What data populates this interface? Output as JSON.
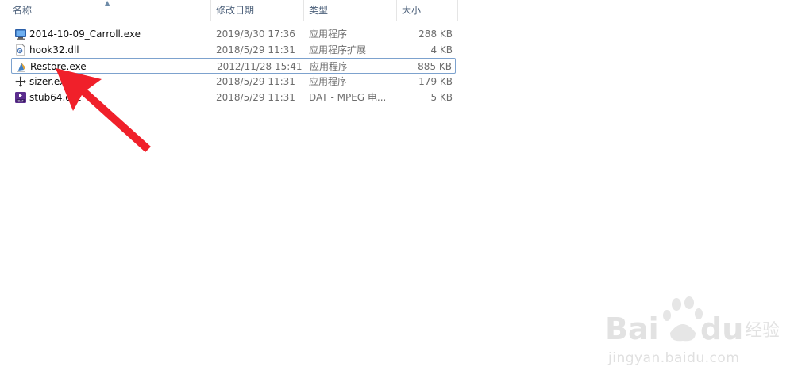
{
  "columns": {
    "name": "名称",
    "date": "修改日期",
    "type": "类型",
    "size": "大小"
  },
  "files": [
    {
      "name": "2014-10-09_Carroll.exe",
      "date": "2019/3/30 17:36",
      "type": "应用程序",
      "size": "288 KB",
      "icon": "monitor-app-icon"
    },
    {
      "name": "hook32.dll",
      "date": "2018/5/29 11:31",
      "type": "应用程序扩展",
      "size": "4 KB",
      "icon": "dll-file-icon"
    },
    {
      "name": "Restore.exe",
      "date": "2012/11/28 15:41",
      "type": "应用程序",
      "size": "885 KB",
      "icon": "restore-app-icon",
      "selected": true
    },
    {
      "name": "sizer.exe",
      "date": "2018/5/29 11:31",
      "type": "应用程序",
      "size": "179 KB",
      "icon": "move-arrows-icon"
    },
    {
      "name": "stub64.dat",
      "date": "2018/5/29 11:31",
      "type": "DAT - MPEG 电...",
      "size": "5 KB",
      "icon": "dat-file-icon"
    }
  ],
  "watermark": {
    "logo": "Baidu 经验",
    "url": "jingyan.baidu.com"
  },
  "colors": {
    "arrow": "#f0202a",
    "selection_border": "#7da2ce",
    "header_text": "#4c607a"
  }
}
